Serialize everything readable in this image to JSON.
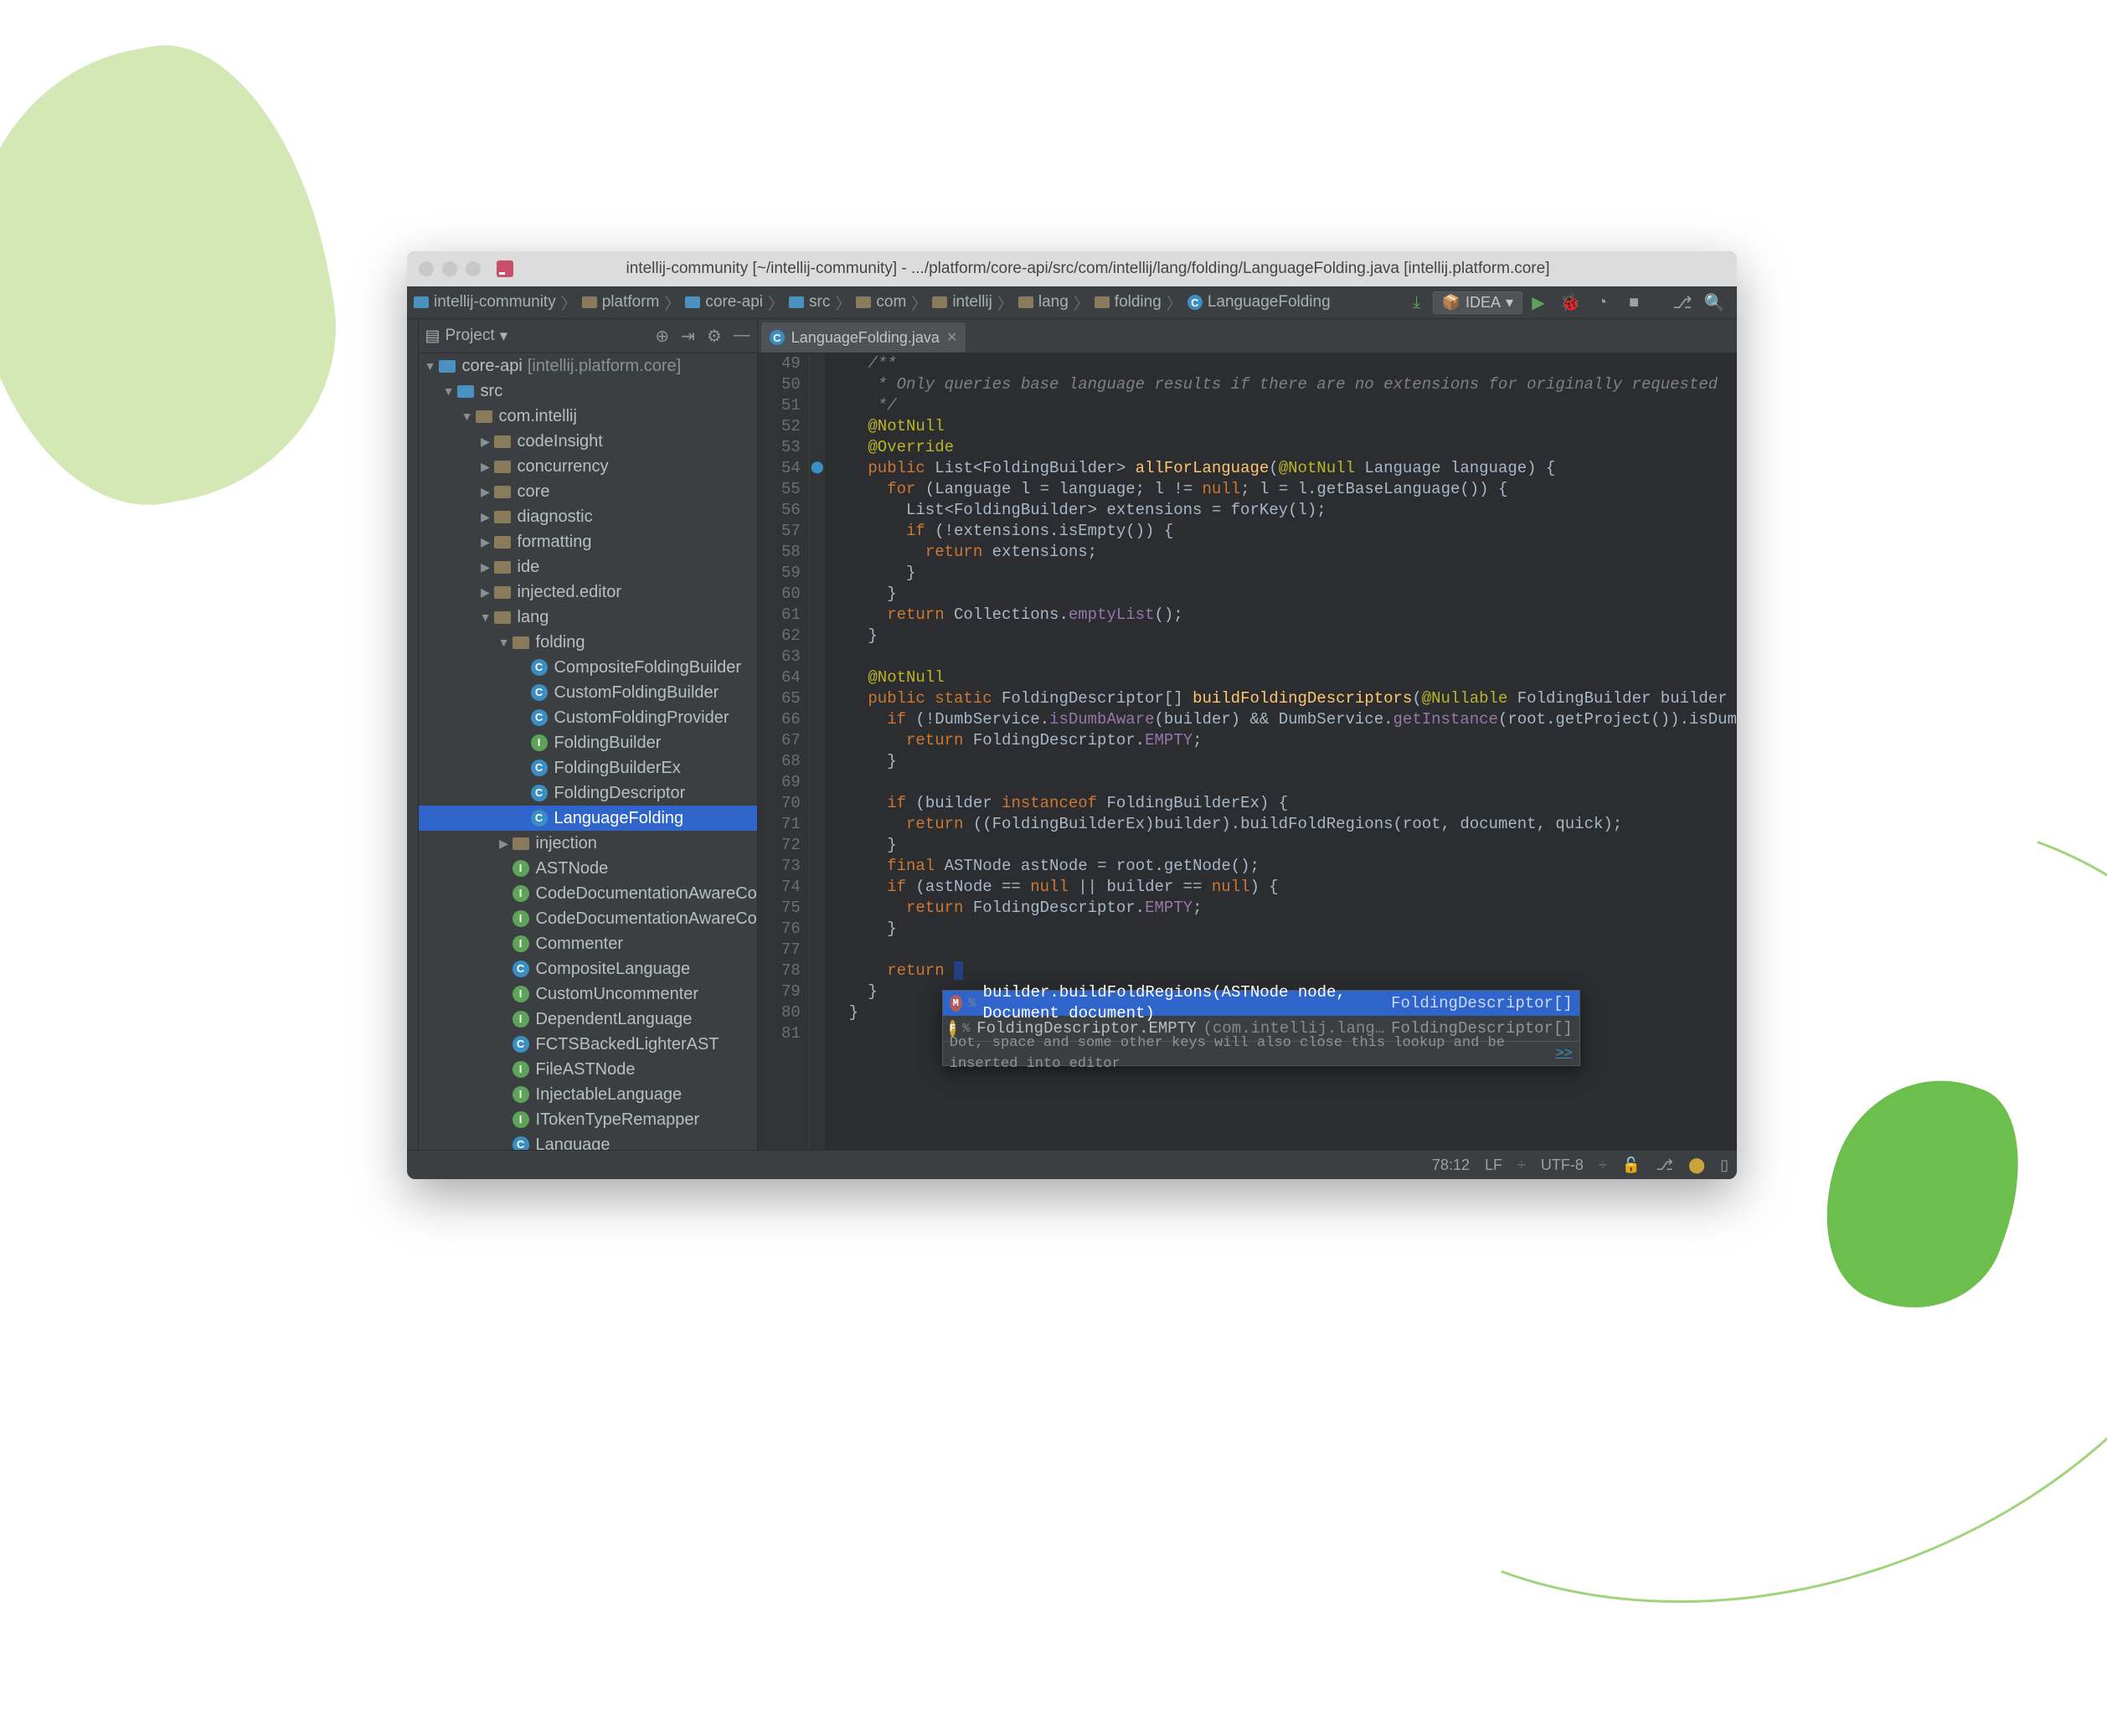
{
  "titlebar": {
    "title": "intellij-community [~/intellij-community] - .../platform/core-api/src/com/intellij/lang/folding/LanguageFolding.java [intellij.platform.core]"
  },
  "breadcrumbs": [
    "intellij-community",
    "platform",
    "core-api",
    "src",
    "com",
    "intellij",
    "lang",
    "folding",
    "LanguageFolding"
  ],
  "run_config": "IDEA",
  "project_panel": {
    "title": "Project",
    "root": {
      "name": "core-api",
      "suffix": "[intellij.platform.core]"
    },
    "src": "src",
    "pkg": "com.intellij",
    "dirs": [
      "codeInsight",
      "concurrency",
      "core",
      "diagnostic",
      "formatting",
      "ide",
      "injected.editor"
    ],
    "lang": "lang",
    "folding": "folding",
    "folding_items": [
      {
        "kind": "c",
        "name": "CompositeFoldingBuilder"
      },
      {
        "kind": "c",
        "name": "CustomFoldingBuilder"
      },
      {
        "kind": "c",
        "name": "CustomFoldingProvider"
      },
      {
        "kind": "i",
        "name": "FoldingBuilder"
      },
      {
        "kind": "c",
        "name": "FoldingBuilderEx"
      },
      {
        "kind": "c",
        "name": "FoldingDescriptor"
      },
      {
        "kind": "c",
        "name": "LanguageFolding",
        "selected": true
      }
    ],
    "injection": "injection",
    "root_items": [
      {
        "kind": "i",
        "name": "ASTNode"
      },
      {
        "kind": "i",
        "name": "CodeDocumentationAwareCo"
      },
      {
        "kind": "i",
        "name": "CodeDocumentationAwareCo"
      },
      {
        "kind": "i",
        "name": "Commenter"
      },
      {
        "kind": "c",
        "name": "CompositeLanguage"
      },
      {
        "kind": "i",
        "name": "CustomUncommenter"
      },
      {
        "kind": "i",
        "name": "DependentLanguage"
      },
      {
        "kind": "c",
        "name": "FCTSBackedLighterAST"
      },
      {
        "kind": "i",
        "name": "FileASTNode"
      },
      {
        "kind": "i",
        "name": "InjectableLanguage"
      },
      {
        "kind": "i",
        "name": "ITokenTypeRemapper"
      },
      {
        "kind": "c",
        "name": "Language"
      }
    ]
  },
  "tab": {
    "name": "LanguageFolding.java"
  },
  "gutter_start": 49,
  "gutter_end": 81,
  "code_lines": [
    {
      "n": 49,
      "html": "    <span class='com'>/**</span>"
    },
    {
      "n": 50,
      "html": "    <span class='com'> * Only queries base language results if there are no extensions for originally requested</span>"
    },
    {
      "n": 51,
      "html": "    <span class='com'> */</span>"
    },
    {
      "n": 52,
      "html": "    <span class='ann'>@NotNull</span>"
    },
    {
      "n": 53,
      "html": "    <span class='ann'>@Override</span>"
    },
    {
      "n": 54,
      "html": "    <span class='kw'>public</span> List&lt;FoldingBuilder&gt; <span class='mth'>allForLanguage</span>(<span class='ann'>@NotNull</span> Language <span class='par'>language</span>) {",
      "mark": "override"
    },
    {
      "n": 55,
      "html": "      <span class='kw'>for</span> (Language <span class='par'>l</span> = language; <span class='par'>l</span> != <span class='kw'>null</span>; <span class='par'>l</span> = <span class='par'>l</span>.getBaseLanguage()) {"
    },
    {
      "n": 56,
      "html": "        List&lt;FoldingBuilder&gt; extensions = forKey(<span class='par'>l</span>);"
    },
    {
      "n": 57,
      "html": "        <span class='kw'>if</span> (!extensions.isEmpty()) {"
    },
    {
      "n": 58,
      "html": "          <span class='kw'>return</span> extensions;"
    },
    {
      "n": 59,
      "html": "        }"
    },
    {
      "n": 60,
      "html": "      }"
    },
    {
      "n": 61,
      "html": "      <span class='kw'>return</span> Collections.<span class='fld'>emptyList</span>();"
    },
    {
      "n": 62,
      "html": "    }"
    },
    {
      "n": 63,
      "html": ""
    },
    {
      "n": 64,
      "html": "    <span class='ann'>@NotNull</span>"
    },
    {
      "n": 65,
      "html": "    <span class='kw'>public static</span> FoldingDescriptor[] <span class='mth'>buildFoldingDescriptors</span>(<span class='ann'>@Nullable</span> FoldingBuilder <span class='par'>builder</span>"
    },
    {
      "n": 66,
      "html": "      <span class='kw'>if</span> (!DumbService.<span class='fld'>isDumbAware</span>(builder) &amp;&amp; DumbService.<span class='fld'>getInstance</span>(<span class='par'>root</span>.getProject()).isDum"
    },
    {
      "n": 67,
      "html": "        <span class='kw'>return</span> FoldingDescriptor.<span class='fld'>EMPTY</span>;"
    },
    {
      "n": 68,
      "html": "      }"
    },
    {
      "n": 69,
      "html": ""
    },
    {
      "n": 70,
      "html": "      <span class='kw'>if</span> (builder <span class='kw'>instanceof</span> FoldingBuilderEx) {"
    },
    {
      "n": 71,
      "html": "        <span class='kw'>return</span> ((FoldingBuilderEx)builder).buildFoldRegions(<span class='par'>root</span>, <span class='par'>document</span>, <span class='par'>quick</span>);"
    },
    {
      "n": 72,
      "html": "      }"
    },
    {
      "n": 73,
      "html": "      <span class='kw'>final</span> ASTNode <span class='par'>astNode</span> = <span class='par'>root</span>.getNode();"
    },
    {
      "n": 74,
      "html": "      <span class='kw'>if</span> (astNode == <span class='kw'>null</span> || builder == <span class='kw'>null</span>) {"
    },
    {
      "n": 75,
      "html": "        <span class='kw'>return</span> FoldingDescriptor.<span class='fld'>EMPTY</span>;"
    },
    {
      "n": 76,
      "html": "      }"
    },
    {
      "n": 77,
      "html": ""
    },
    {
      "n": 78,
      "html": "      <span class='kw'>return</span> <span style='background:#214283'>&nbsp;</span>"
    },
    {
      "n": 79,
      "html": "    }"
    },
    {
      "n": 80,
      "html": "  }"
    },
    {
      "n": 81,
      "html": ""
    }
  ],
  "completion": {
    "items": [
      {
        "badge": "m",
        "label": "builder.buildFoldRegions(ASTNode node, Document document)",
        "type": "FoldingDescriptor[]",
        "selected": true,
        "pct": "%"
      },
      {
        "badge": "f",
        "label": "FoldingDescriptor.EMPTY",
        "grey": "(com.intellij.lang…",
        "type": "FoldingDescriptor[]",
        "pct": "%"
      }
    ],
    "hint": "Dot, space and some other keys will also close this lookup and be inserted into editor",
    "hint_link": ">>"
  },
  "status": {
    "pos": "78:12",
    "lf": "LF",
    "enc": "UTF-8"
  }
}
